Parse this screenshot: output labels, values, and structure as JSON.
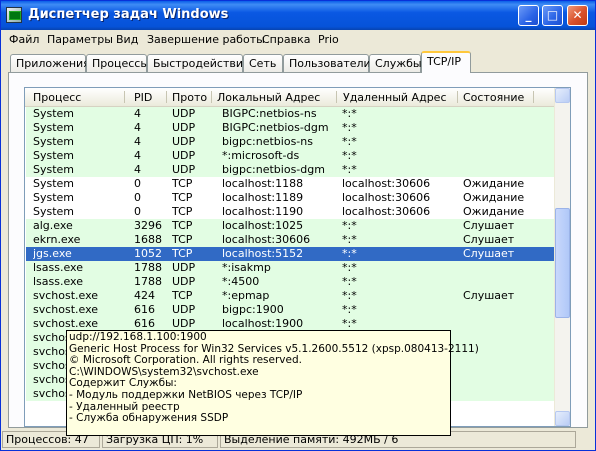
{
  "window": {
    "title": "Диспетчер задач Windows"
  },
  "menu": [
    "Файл",
    "Параметры",
    "Вид",
    "Завершение работы",
    "Справка",
    "Prio"
  ],
  "tabs": [
    "Приложения",
    "Процессы",
    "Быстродействие",
    "Сеть",
    "Пользователи",
    "Службы",
    "TCP/IP"
  ],
  "active_tab": "TCP/IP",
  "columns": [
    "Процесс",
    "PID",
    "Прото",
    "Локальный Адрес",
    "Удаленный Адрес",
    "Состояние"
  ],
  "rows": [
    {
      "process": "System",
      "pid": "4",
      "proto": "UDP",
      "local": "BIGPC:netbios-ns",
      "remote": "*:*",
      "state": "",
      "style": "green"
    },
    {
      "process": "System",
      "pid": "4",
      "proto": "UDP",
      "local": "BIGPC:netbios-dgm",
      "remote": "*:*",
      "state": "",
      "style": "green"
    },
    {
      "process": "System",
      "pid": "4",
      "proto": "UDP",
      "local": "bigpc:netbios-ns",
      "remote": "*:*",
      "state": "",
      "style": "green"
    },
    {
      "process": "System",
      "pid": "4",
      "proto": "UDP",
      "local": "*:microsoft-ds",
      "remote": "*:*",
      "state": "",
      "style": "green"
    },
    {
      "process": "System",
      "pid": "4",
      "proto": "UDP",
      "local": "bigpc:netbios-dgm",
      "remote": "*:*",
      "state": "",
      "style": "green"
    },
    {
      "process": "System",
      "pid": "0",
      "proto": "TCP",
      "local": "localhost:1188",
      "remote": "localhost:30606",
      "state": "Ожидание",
      "style": "white"
    },
    {
      "process": "System",
      "pid": "0",
      "proto": "TCP",
      "local": "localhost:1189",
      "remote": "localhost:30606",
      "state": "Ожидание",
      "style": "white"
    },
    {
      "process": "System",
      "pid": "0",
      "proto": "TCP",
      "local": "localhost:1190",
      "remote": "localhost:30606",
      "state": "Ожидание",
      "style": "white"
    },
    {
      "process": "alg.exe",
      "pid": "3296",
      "proto": "TCP",
      "local": "localhost:1025",
      "remote": "*:*",
      "state": "Слушает",
      "style": "green"
    },
    {
      "process": "ekrn.exe",
      "pid": "1688",
      "proto": "TCP",
      "local": "localhost:30606",
      "remote": "*:*",
      "state": "Слушает",
      "style": "green"
    },
    {
      "process": "jgs.exe",
      "pid": "1052",
      "proto": "TCP",
      "local": "localhost:5152",
      "remote": "*:*",
      "state": "Слушает",
      "style": "sel"
    },
    {
      "process": "lsass.exe",
      "pid": "1788",
      "proto": "UDP",
      "local": "*:isakmp",
      "remote": "*:*",
      "state": "",
      "style": "green"
    },
    {
      "process": "lsass.exe",
      "pid": "1788",
      "proto": "UDP",
      "local": "*:4500",
      "remote": "*:*",
      "state": "",
      "style": "green"
    },
    {
      "process": "svchost.exe",
      "pid": "424",
      "proto": "TCP",
      "local": "*:epmap",
      "remote": "*:*",
      "state": "Слушает",
      "style": "green"
    },
    {
      "process": "svchost.exe",
      "pid": "616",
      "proto": "UDP",
      "local": "bigpc:1900",
      "remote": "*:*",
      "state": "",
      "style": "green"
    },
    {
      "process": "svchost.exe",
      "pid": "616",
      "proto": "UDP",
      "local": "localhost:1900",
      "remote": "*:*",
      "state": "",
      "style": "green"
    },
    {
      "process": "svchost",
      "pid": "",
      "proto": "",
      "local": "",
      "remote": "",
      "state": "",
      "style": "green"
    },
    {
      "process": "svchost",
      "pid": "",
      "proto": "",
      "local": "",
      "remote": "",
      "state": "",
      "style": "green"
    },
    {
      "process": "svchost",
      "pid": "",
      "proto": "",
      "local": "",
      "remote": "",
      "state": "",
      "style": "green"
    },
    {
      "process": "svchost",
      "pid": "",
      "proto": "",
      "local": "",
      "remote": "",
      "state": "",
      "style": "green"
    },
    {
      "process": "svchost",
      "pid": "",
      "proto": "",
      "local": "",
      "remote": "",
      "state": "",
      "style": "green"
    }
  ],
  "tooltip": [
    "udp://192.168.1.100:1900",
    "Generic Host Process for Win32 Services v5.1.2600.5512 (xpsp.080413-2111)",
    "© Microsoft Corporation. All rights reserved.",
    "C:\\WINDOWS\\system32\\svchost.exe",
    "Содержит Службы:",
    " - Модуль поддержки NetBIOS через TCP/IP",
    " - Удаленный реестр",
    " - Служба обнаружения SSDP"
  ],
  "status": {
    "processes": "Процессов: 47",
    "cpu": "Загрузка ЦП: 1%",
    "memory": "Выделение памяти: 492МБ / 6"
  }
}
